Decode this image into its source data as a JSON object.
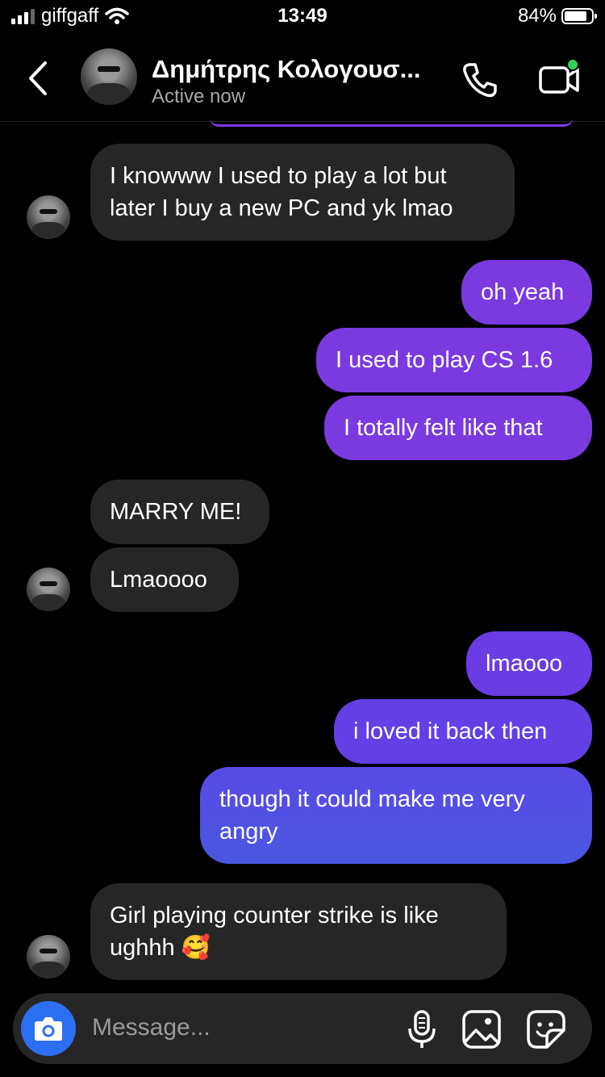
{
  "status_bar": {
    "carrier": "giffgaff",
    "time": "13:49",
    "battery": "84%",
    "battery_level": 0.84
  },
  "header": {
    "name": "Δημήτρης Κολογουσ...",
    "status": "Active now"
  },
  "messages": [
    {
      "from": "them",
      "text": "I knowww I used to play a lot but later I buy a new PC and yk lmao"
    },
    {
      "from": "me",
      "text": "oh yeah"
    },
    {
      "from": "me",
      "text": "I used to play CS 1.6"
    },
    {
      "from": "me",
      "text": "I totally felt like that"
    },
    {
      "from": "them",
      "text": "MARRY ME!"
    },
    {
      "from": "them",
      "text": "Lmaoooo"
    },
    {
      "from": "me",
      "text": "lmaooo"
    },
    {
      "from": "me",
      "text": "i loved it back then"
    },
    {
      "from": "me",
      "text": "though it could make me very angry"
    },
    {
      "from": "them",
      "text": "Girl playing counter strike is like ughhh 🥰"
    }
  ],
  "composer": {
    "placeholder": "Message..."
  },
  "colors": {
    "outgoing_purple": "#7a3ae0",
    "outgoing_indigo": "#6240e6",
    "outgoing_blue": "#4a56e0",
    "incoming": "#262626",
    "camera": "#2d6ff2",
    "online": "#31d158"
  }
}
